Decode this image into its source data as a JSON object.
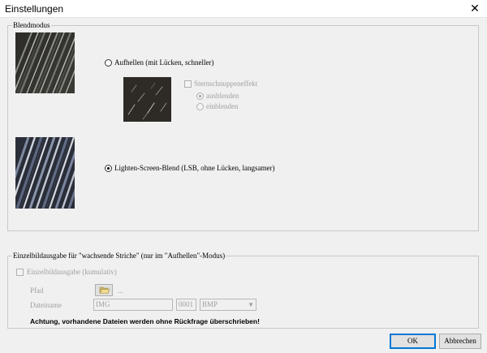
{
  "window": {
    "title": "Einstellungen",
    "close_glyph": "✕"
  },
  "blendmodus": {
    "legend": "Blendmodus",
    "option_aufhellen": "Aufhellen (mit Lücken, schneller)",
    "option_aufhellen_checked": false,
    "sternschnuppen_label": "Sternschnuppeneffekt",
    "ausblenden_label": "ausblenden",
    "ausblenden_checked": true,
    "einblenden_label": "einblenden",
    "einblenden_checked": false,
    "option_lsb": "Lighten-Screen-Blend (LSB, ohne Lücken, langsamer)",
    "option_lsb_checked": true
  },
  "einzelbild": {
    "legend": "Einzelbildausgabe für \"wachsende Striche\" (nur im \"Aufhellen\"-Modus)",
    "checkbox_label": "Einzelbildausgabe (kumulativ)",
    "pfad_label": "Pfad",
    "pfad_value": "...",
    "dateiname_label": "Dateiname",
    "dateiname_value": "IMG",
    "number_value": "0001",
    "format_value": "BMP",
    "warning": "Achtung, vorhandene Dateien werden ohne Rückfrage überschrieben!"
  },
  "buttons": {
    "ok": "OK",
    "abbrechen": "Abbrechen"
  },
  "icons": {
    "close": "close-icon",
    "folder": "folder-open-icon"
  }
}
